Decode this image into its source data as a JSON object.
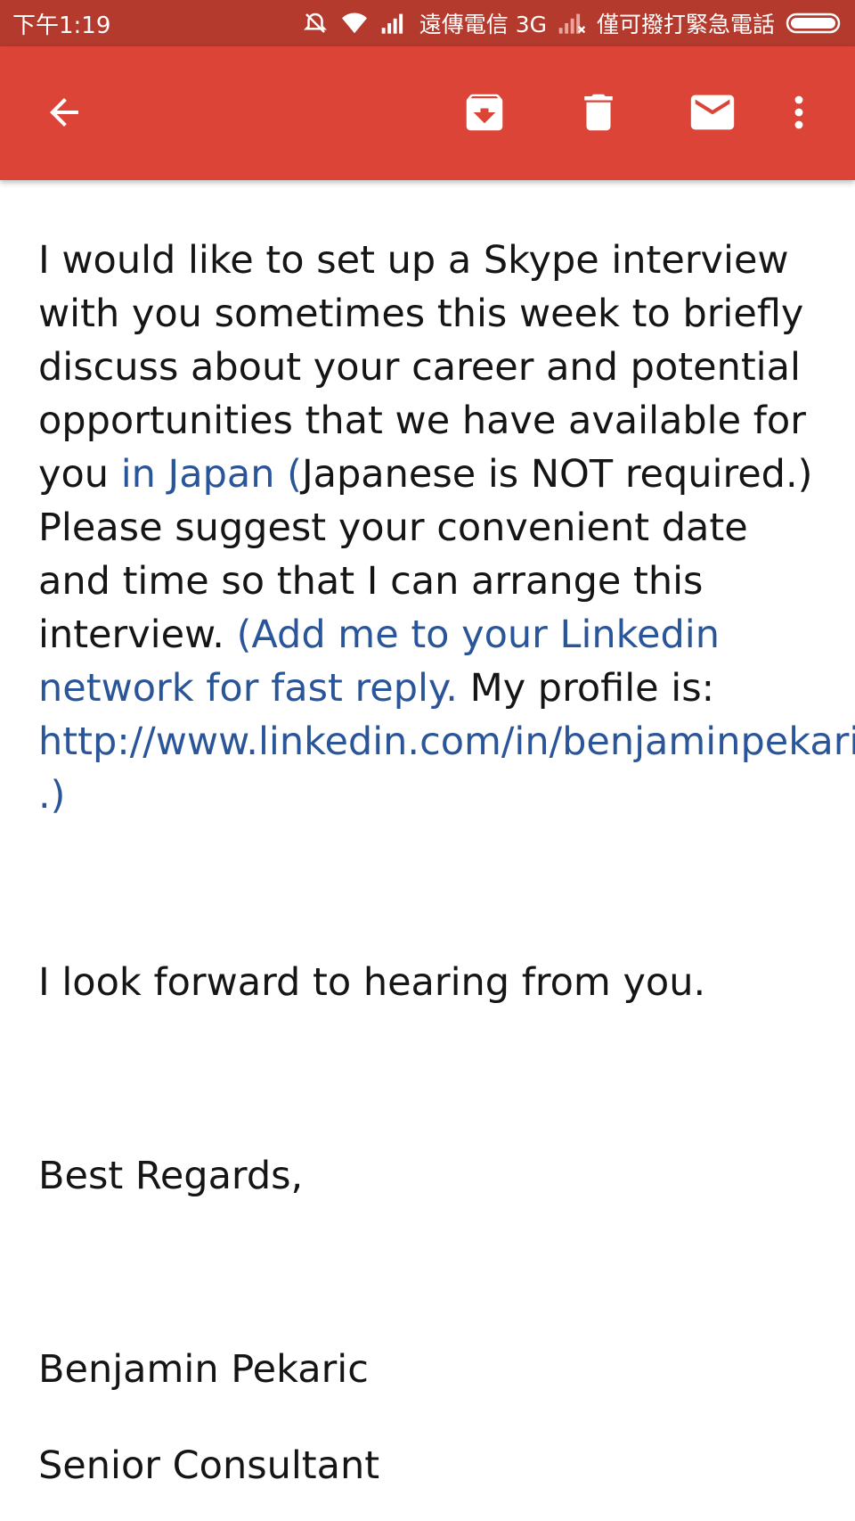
{
  "status_bar": {
    "time": "下午1:19",
    "carrier_primary": "遠傳電信 3G",
    "carrier_secondary": "僅可撥打緊急電話"
  },
  "toolbar": {
    "back_icon": "arrow-back-icon",
    "archive_icon": "archive-icon",
    "delete_icon": "trash-icon",
    "mail_icon": "mark-unread-mail-icon",
    "more_icon": "more-vert-icon",
    "accent_color": "#db4437"
  },
  "email": {
    "body_segments": [
      "I would like to set up a Skype interview with you sometimes this week to briefly discuss about your career and potential opportunities that we have available for you ",
      "in Japan (",
      "Japanese is NOT required.) Please suggest your convenient date and time so that I can arrange this interview. ",
      "(Add me to your Linkedin network for fast reply.",
      " My profile is: ",
      "http://www.linkedin.com/in/benjaminpekaric .)"
    ],
    "closing": "I look forward to hearing from you.",
    "regards": "Best Regards,",
    "sender_name": "Benjamin Pekaric",
    "sender_title": "Senior Consultant",
    "link_color": "#2a5699"
  }
}
